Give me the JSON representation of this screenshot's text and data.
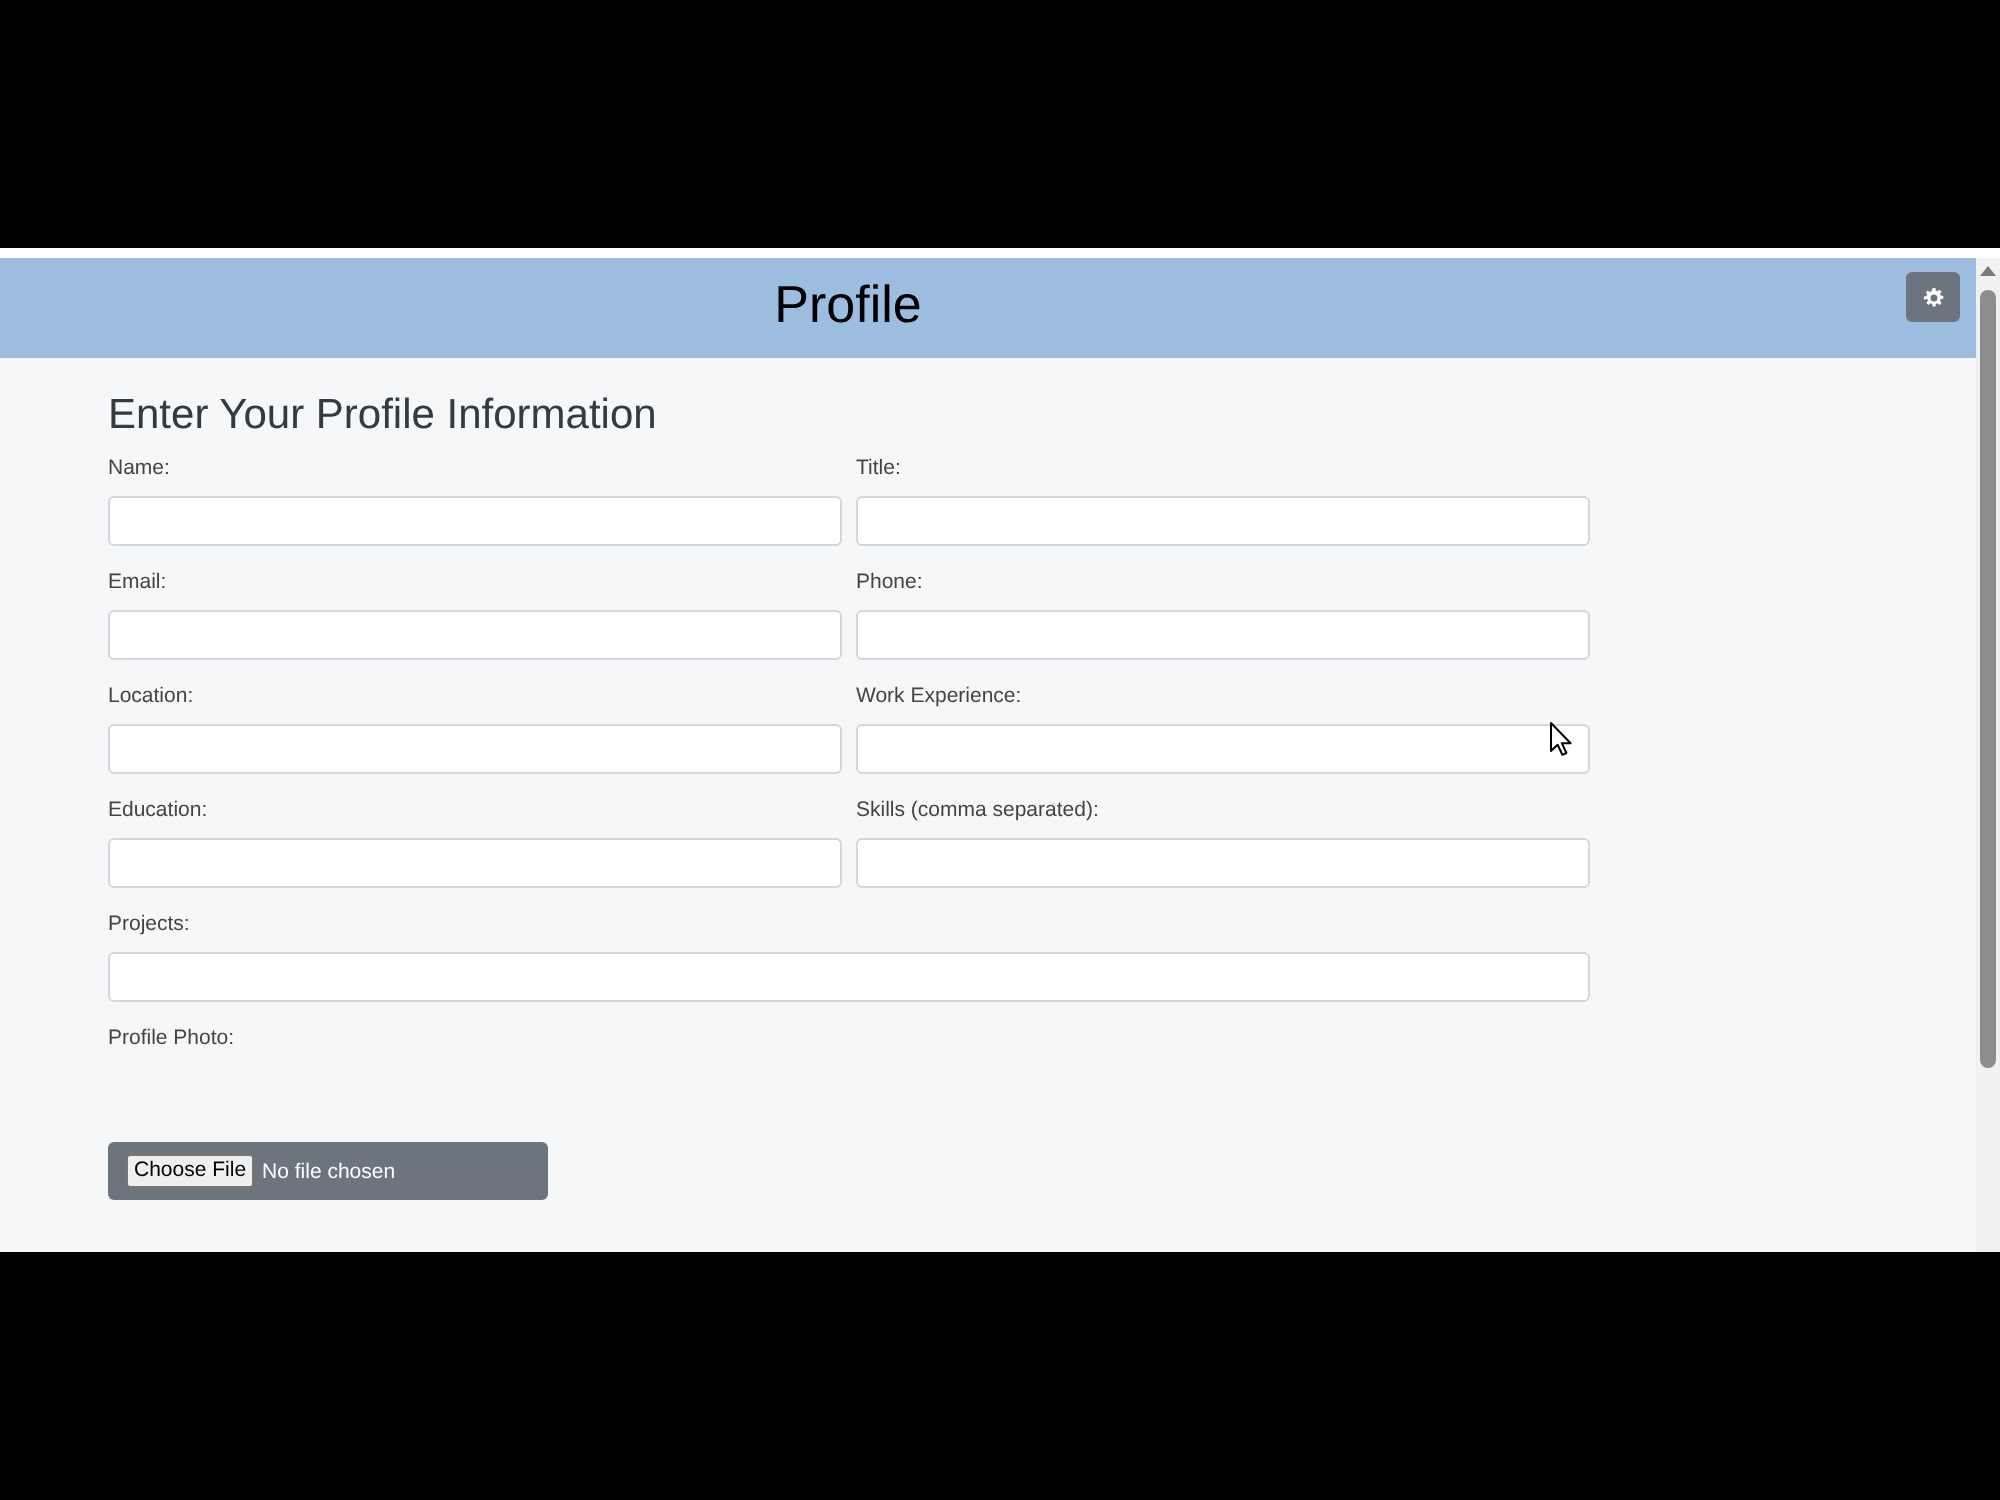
{
  "header": {
    "title": "Profile"
  },
  "form": {
    "heading": "Enter Your Profile Information",
    "rows": [
      {
        "fields": [
          {
            "label": "Name:"
          },
          {
            "label": "Title:"
          }
        ]
      },
      {
        "fields": [
          {
            "label": "Email:"
          },
          {
            "label": "Phone:"
          }
        ]
      },
      {
        "fields": [
          {
            "label": "Location:"
          },
          {
            "label": "Work Experience:"
          }
        ]
      },
      {
        "fields": [
          {
            "label": "Education:"
          },
          {
            "label": "Skills (comma separated):"
          }
        ]
      },
      {
        "fields": [
          {
            "label": "Projects:"
          }
        ]
      }
    ],
    "photo": {
      "label": "Profile Photo:",
      "button": "Choose File",
      "status": "No file chosen"
    }
  }
}
